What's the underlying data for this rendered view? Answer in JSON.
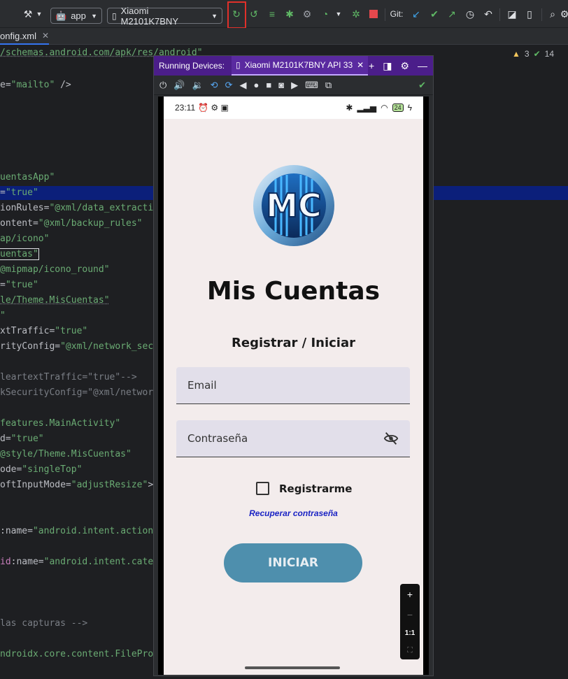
{
  "toolbar": {
    "run_config": "app",
    "device": "Xiaomi M2101K7BNY",
    "git_label": "Git:"
  },
  "tabs": {
    "file_tab": "onfig.xml"
  },
  "editor": {
    "warnings": "3",
    "checks": "14",
    "lines": [
      {
        "t": "/schemas.android.com/apk/res/android\""
      },
      {
        "a": "e=",
        "s": "\"mailto\"",
        "r": " />"
      },
      {
        "s": "uentasApp\""
      },
      {
        "a": "=",
        "s": "\"true\""
      },
      {
        "a": "ionRules=",
        "s": "\"@xml/data_extracti"
      },
      {
        "a": "ontent=",
        "s": "\"@xml/backup_rules\""
      },
      {
        "s": "ap/icono\""
      },
      {
        "s": "uentas\""
      },
      {
        "s": "@mipmap/icono_round\""
      },
      {
        "a": "=",
        "s": "\"true\""
      },
      {
        "s": "le/Theme.MisCuentas\""
      },
      {
        "s": "\""
      },
      {
        "a": "xtTraffic=",
        "s": "\"true\""
      },
      {
        "a": "rityConfig=",
        "s": "\"@xml/network_sec"
      },
      {
        "c": "leartextTraffic=\"true\"-->"
      },
      {
        "c": "kSecurityConfig=\"@xml/networ"
      },
      {
        "s": "features.MainActivity\""
      },
      {
        "a": "d=",
        "s": "\"true\""
      },
      {
        "s": "@style/Theme.MisCuentas\""
      },
      {
        "a": "ode=",
        "s": "\"singleTop\""
      },
      {
        "a": "oftInputMode=",
        "s": "\"adjustResize\"",
        "r": ">"
      },
      {
        "a": ":name=",
        "s": "\"android.intent.action"
      },
      {
        "n": "id",
        "a": ":name=",
        "s": "\"android.intent.cate"
      },
      {
        "c": "las capturas -->"
      },
      {
        "s": "ndroidx.core.content.FilePro"
      }
    ]
  },
  "running_devices": {
    "title": "Running Devices:",
    "tab_label": "Xiaomi M2101K7BNY API 33"
  },
  "phone": {
    "time": "23:11",
    "battery": "24",
    "app_title": "Mis Cuentas",
    "subtitle": "Registrar / Iniciar",
    "email_label": "Email",
    "password_label": "Contraseña",
    "register_label": "Registrarme",
    "recover_link": "Recuperar contraseña",
    "login_button": "INICIAR",
    "logo_text": "MC"
  },
  "zoom": {
    "plus": "+",
    "minus": "−",
    "one_to_one": "1:1"
  },
  "colors": {
    "accent_purple": "#4b1e8a",
    "button_blue": "#4e8fad",
    "link_blue": "#1a23c4",
    "highlight_red": "#e0302a"
  }
}
